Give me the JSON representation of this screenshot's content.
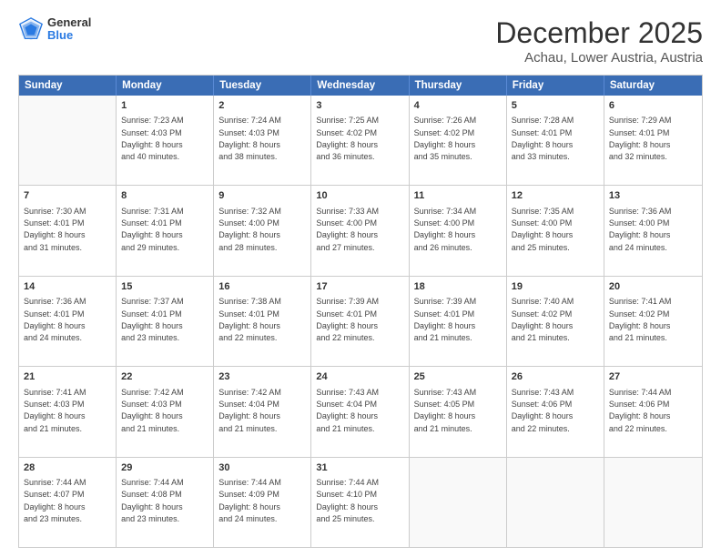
{
  "header": {
    "logo": {
      "general": "General",
      "blue": "Blue"
    },
    "title": "December 2025",
    "location": "Achau, Lower Austria, Austria"
  },
  "weekdays": [
    "Sunday",
    "Monday",
    "Tuesday",
    "Wednesday",
    "Thursday",
    "Friday",
    "Saturday"
  ],
  "rows": [
    [
      {
        "day": "",
        "text": ""
      },
      {
        "day": "1",
        "text": "Sunrise: 7:23 AM\nSunset: 4:03 PM\nDaylight: 8 hours\nand 40 minutes."
      },
      {
        "day": "2",
        "text": "Sunrise: 7:24 AM\nSunset: 4:03 PM\nDaylight: 8 hours\nand 38 minutes."
      },
      {
        "day": "3",
        "text": "Sunrise: 7:25 AM\nSunset: 4:02 PM\nDaylight: 8 hours\nand 36 minutes."
      },
      {
        "day": "4",
        "text": "Sunrise: 7:26 AM\nSunset: 4:02 PM\nDaylight: 8 hours\nand 35 minutes."
      },
      {
        "day": "5",
        "text": "Sunrise: 7:28 AM\nSunset: 4:01 PM\nDaylight: 8 hours\nand 33 minutes."
      },
      {
        "day": "6",
        "text": "Sunrise: 7:29 AM\nSunset: 4:01 PM\nDaylight: 8 hours\nand 32 minutes."
      }
    ],
    [
      {
        "day": "7",
        "text": "Sunrise: 7:30 AM\nSunset: 4:01 PM\nDaylight: 8 hours\nand 31 minutes."
      },
      {
        "day": "8",
        "text": "Sunrise: 7:31 AM\nSunset: 4:01 PM\nDaylight: 8 hours\nand 29 minutes."
      },
      {
        "day": "9",
        "text": "Sunrise: 7:32 AM\nSunset: 4:00 PM\nDaylight: 8 hours\nand 28 minutes."
      },
      {
        "day": "10",
        "text": "Sunrise: 7:33 AM\nSunset: 4:00 PM\nDaylight: 8 hours\nand 27 minutes."
      },
      {
        "day": "11",
        "text": "Sunrise: 7:34 AM\nSunset: 4:00 PM\nDaylight: 8 hours\nand 26 minutes."
      },
      {
        "day": "12",
        "text": "Sunrise: 7:35 AM\nSunset: 4:00 PM\nDaylight: 8 hours\nand 25 minutes."
      },
      {
        "day": "13",
        "text": "Sunrise: 7:36 AM\nSunset: 4:00 PM\nDaylight: 8 hours\nand 24 minutes."
      }
    ],
    [
      {
        "day": "14",
        "text": "Sunrise: 7:36 AM\nSunset: 4:01 PM\nDaylight: 8 hours\nand 24 minutes."
      },
      {
        "day": "15",
        "text": "Sunrise: 7:37 AM\nSunset: 4:01 PM\nDaylight: 8 hours\nand 23 minutes."
      },
      {
        "day": "16",
        "text": "Sunrise: 7:38 AM\nSunset: 4:01 PM\nDaylight: 8 hours\nand 22 minutes."
      },
      {
        "day": "17",
        "text": "Sunrise: 7:39 AM\nSunset: 4:01 PM\nDaylight: 8 hours\nand 22 minutes."
      },
      {
        "day": "18",
        "text": "Sunrise: 7:39 AM\nSunset: 4:01 PM\nDaylight: 8 hours\nand 21 minutes."
      },
      {
        "day": "19",
        "text": "Sunrise: 7:40 AM\nSunset: 4:02 PM\nDaylight: 8 hours\nand 21 minutes."
      },
      {
        "day": "20",
        "text": "Sunrise: 7:41 AM\nSunset: 4:02 PM\nDaylight: 8 hours\nand 21 minutes."
      }
    ],
    [
      {
        "day": "21",
        "text": "Sunrise: 7:41 AM\nSunset: 4:03 PM\nDaylight: 8 hours\nand 21 minutes."
      },
      {
        "day": "22",
        "text": "Sunrise: 7:42 AM\nSunset: 4:03 PM\nDaylight: 8 hours\nand 21 minutes."
      },
      {
        "day": "23",
        "text": "Sunrise: 7:42 AM\nSunset: 4:04 PM\nDaylight: 8 hours\nand 21 minutes."
      },
      {
        "day": "24",
        "text": "Sunrise: 7:43 AM\nSunset: 4:04 PM\nDaylight: 8 hours\nand 21 minutes."
      },
      {
        "day": "25",
        "text": "Sunrise: 7:43 AM\nSunset: 4:05 PM\nDaylight: 8 hours\nand 21 minutes."
      },
      {
        "day": "26",
        "text": "Sunrise: 7:43 AM\nSunset: 4:06 PM\nDaylight: 8 hours\nand 22 minutes."
      },
      {
        "day": "27",
        "text": "Sunrise: 7:44 AM\nSunset: 4:06 PM\nDaylight: 8 hours\nand 22 minutes."
      }
    ],
    [
      {
        "day": "28",
        "text": "Sunrise: 7:44 AM\nSunset: 4:07 PM\nDaylight: 8 hours\nand 23 minutes."
      },
      {
        "day": "29",
        "text": "Sunrise: 7:44 AM\nSunset: 4:08 PM\nDaylight: 8 hours\nand 23 minutes."
      },
      {
        "day": "30",
        "text": "Sunrise: 7:44 AM\nSunset: 4:09 PM\nDaylight: 8 hours\nand 24 minutes."
      },
      {
        "day": "31",
        "text": "Sunrise: 7:44 AM\nSunset: 4:10 PM\nDaylight: 8 hours\nand 25 minutes."
      },
      {
        "day": "",
        "text": ""
      },
      {
        "day": "",
        "text": ""
      },
      {
        "day": "",
        "text": ""
      }
    ]
  ]
}
